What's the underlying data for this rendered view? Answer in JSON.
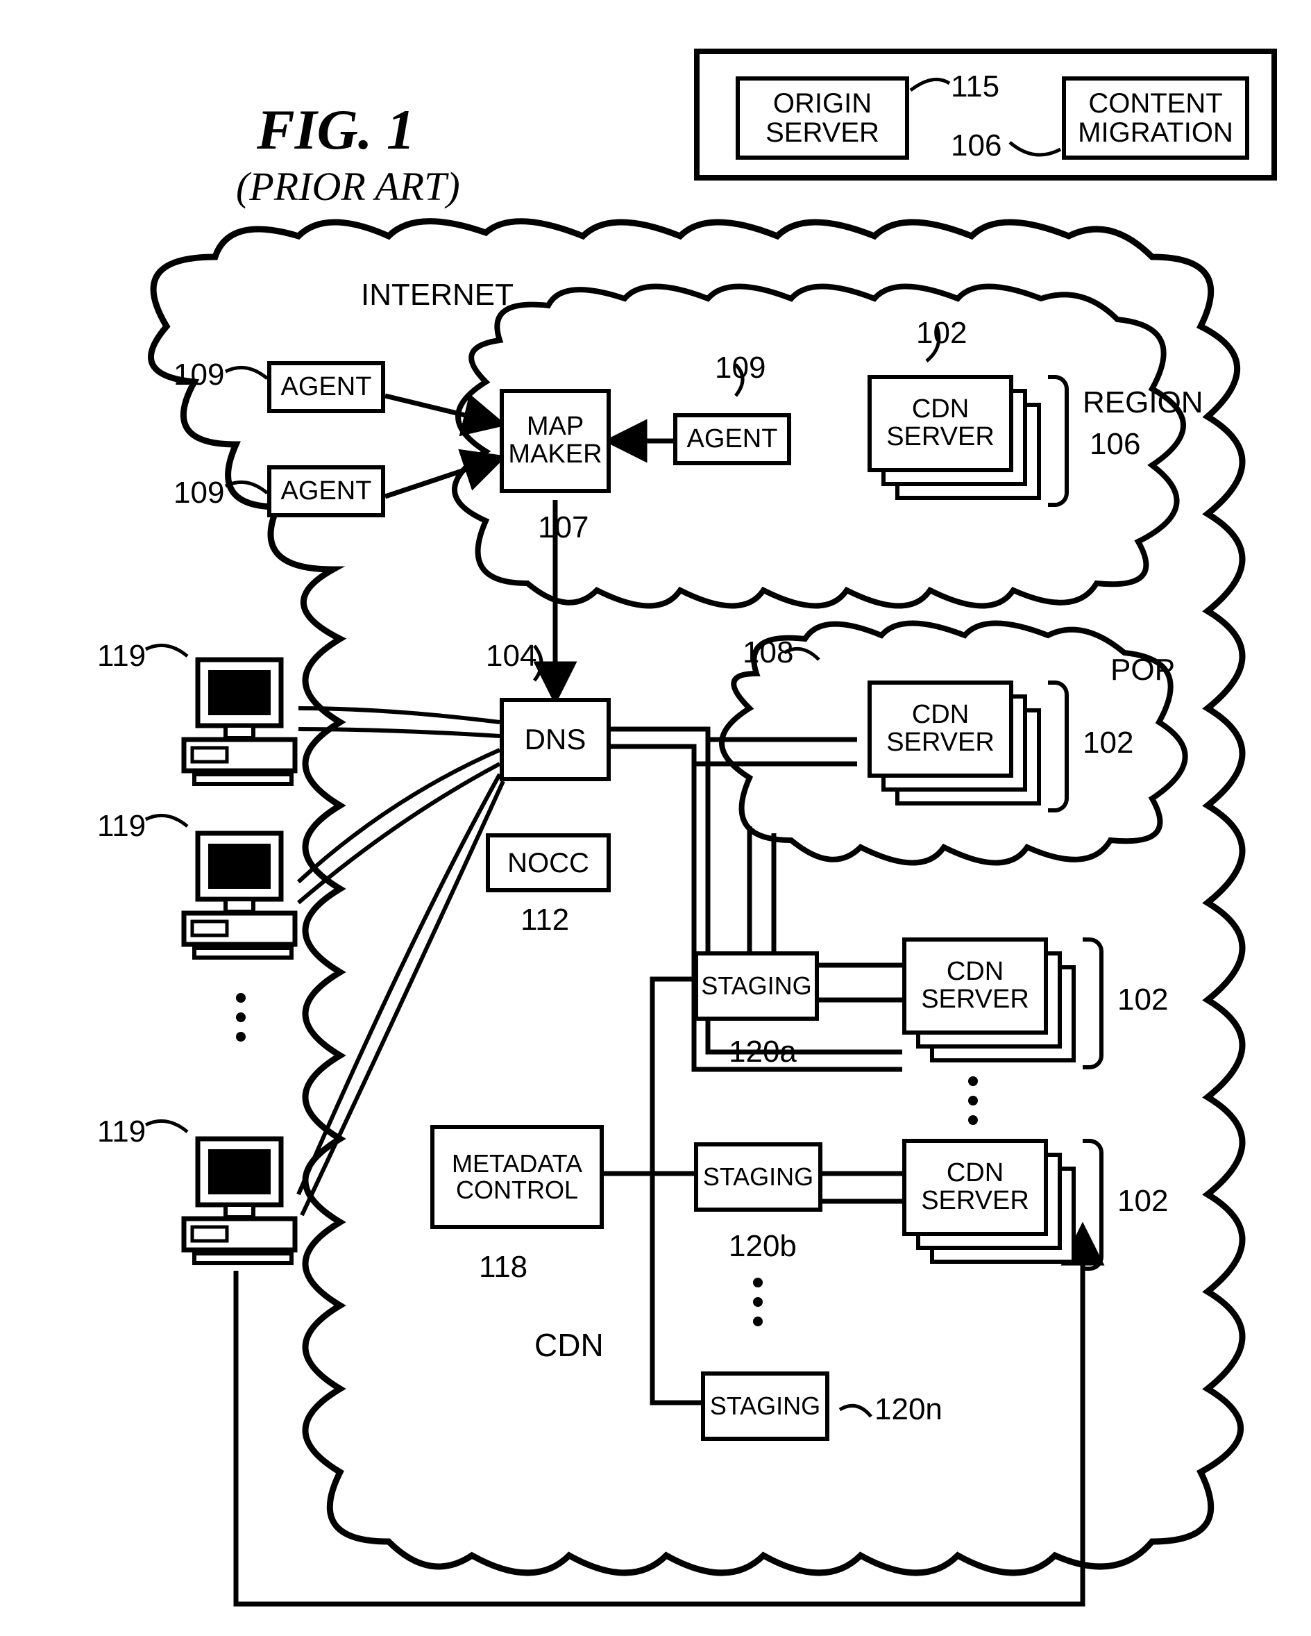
{
  "figure": {
    "title": "FIG. 1",
    "subtitle": "(PRIOR ART)"
  },
  "legend": {
    "origin_server": "ORIGIN\nSERVER",
    "origin_server_ref": "115",
    "content_migration": "CONTENT\nMIGRATION",
    "content_migration_ref": "106"
  },
  "clouds": {
    "internet": "INTERNET",
    "region": "REGION",
    "region_ref": "106",
    "pop": "POP",
    "cdn": "CDN"
  },
  "nodes": {
    "agent": "AGENT",
    "agent_ref": "109",
    "map_maker": "MAP\nMAKER",
    "map_maker_ref": "107",
    "cdn_server": "CDN\nSERVER",
    "cdn_server_ref_102": "102",
    "dns": "DNS",
    "dns_ref": "104",
    "nocc": "NOCC",
    "nocc_ref": "112",
    "staging": "STAGING",
    "staging_ref_a": "120a",
    "staging_ref_b": "120b",
    "staging_ref_n": "120n",
    "metadata_control": "METADATA\nCONTROL",
    "metadata_control_ref": "118",
    "pop_cloud_ref": "108",
    "client_ref": "119"
  }
}
